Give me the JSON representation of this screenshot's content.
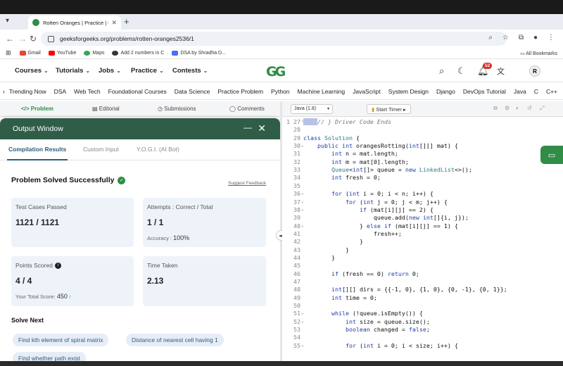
{
  "browser": {
    "tab_title": "Rotten Oranges | Practice | G",
    "url": "geeksforgeeks.org/problems/rotten-oranges2536/1",
    "bookmarks": [
      "Gmail",
      "YouTube",
      "Maps",
      "Add 2 numbers in C",
      "DSA by Shradha D..."
    ],
    "all_bookmarks": "All Bookmarks",
    "notification_count": "52",
    "avatar_letter": "R"
  },
  "nav": {
    "menus": [
      "Courses",
      "Tutorials",
      "Jobs",
      "Practice",
      "Contests"
    ],
    "categories": [
      "Trending Now",
      "DSA",
      "Web Tech",
      "Foundational Courses",
      "Data Science",
      "Practice Problem",
      "Python",
      "Machine Learning",
      "JavaScript",
      "System Design",
      "Django",
      "DevOps Tutorial",
      "Java",
      "C",
      "C++"
    ]
  },
  "problem_tabs": {
    "problem": "Problem",
    "editorial": "Editorial",
    "submissions": "Submissions",
    "comments": "Comments"
  },
  "output": {
    "title": "Output Window",
    "tabs": [
      "Compilation Results",
      "Custom Input",
      "Y.O.G.I. (AI Bot)"
    ],
    "status": "Problem Solved Successfully",
    "feedback": "Suggest Feedback",
    "test_cases_label": "Test Cases Passed",
    "test_cases_value": "1121 / 1121",
    "attempts_label": "Attempts : Correct / Total",
    "attempts_value": "1 / 1",
    "accuracy_label": "Accuracy :",
    "accuracy_value": "100%",
    "points_label": "Points Scored",
    "points_value": "4 / 4",
    "total_score_label": "Your Total Score:",
    "total_score_value": "450",
    "time_label": "Time Taken",
    "time_value": "2.13",
    "solve_next": "Solve Next",
    "suggestions": [
      "Find kth element of spiral matrix",
      "Distance of nearest cell having 1",
      "Find whether path exist"
    ]
  },
  "editor": {
    "language": "Java (1.8)",
    "timer_label": "Start Timer",
    "lines": [
      {
        "n": "27",
        "t": "// } Driver Code Ends"
      },
      {
        "n": "28",
        "t": ""
      },
      {
        "n": "29",
        "t": "class Solution {"
      },
      {
        "n": "30",
        "t": "    public int orangesRotting(int[][] mat) {"
      },
      {
        "n": "31",
        "t": "        int n = mat.length;"
      },
      {
        "n": "32",
        "t": "        int m = mat[0].length;"
      },
      {
        "n": "33",
        "t": "        Queue<int[]> queue = new LinkedList<>();"
      },
      {
        "n": "34",
        "t": "        int fresh = 0;"
      },
      {
        "n": "35",
        "t": ""
      },
      {
        "n": "36",
        "t": "        for (int i = 0; i < n; i++) {"
      },
      {
        "n": "37",
        "t": "            for (int j = 0; j < m; j++) {"
      },
      {
        "n": "38",
        "t": "                if (mat[i][j] == 2) {"
      },
      {
        "n": "39",
        "t": "                    queue.add(new int[]{i, j});"
      },
      {
        "n": "40",
        "t": "                } else if (mat[i][j] == 1) {"
      },
      {
        "n": "41",
        "t": "                    fresh++;"
      },
      {
        "n": "42",
        "t": "                }"
      },
      {
        "n": "43",
        "t": "            }"
      },
      {
        "n": "44",
        "t": "        }"
      },
      {
        "n": "45",
        "t": ""
      },
      {
        "n": "46",
        "t": "        if (fresh == 0) return 0;"
      },
      {
        "n": "47",
        "t": ""
      },
      {
        "n": "48",
        "t": "        int[][] dirs = {{-1, 0}, {1, 0}, {0, -1}, {0, 1}};"
      },
      {
        "n": "49",
        "t": "        int time = 0;"
      },
      {
        "n": "50",
        "t": ""
      },
      {
        "n": "51",
        "t": "        while (!queue.isEmpty()) {"
      },
      {
        "n": "52",
        "t": "            int size = queue.size();"
      },
      {
        "n": "53",
        "t": "            boolean changed = false;"
      },
      {
        "n": "54",
        "t": ""
      },
      {
        "n": "55",
        "t": "            for (int i = 0; i < size; i++) {"
      }
    ],
    "first_line_number": "1"
  },
  "colors": {
    "brand_green": "#2f8d46",
    "output_header": "#2f5d48"
  }
}
